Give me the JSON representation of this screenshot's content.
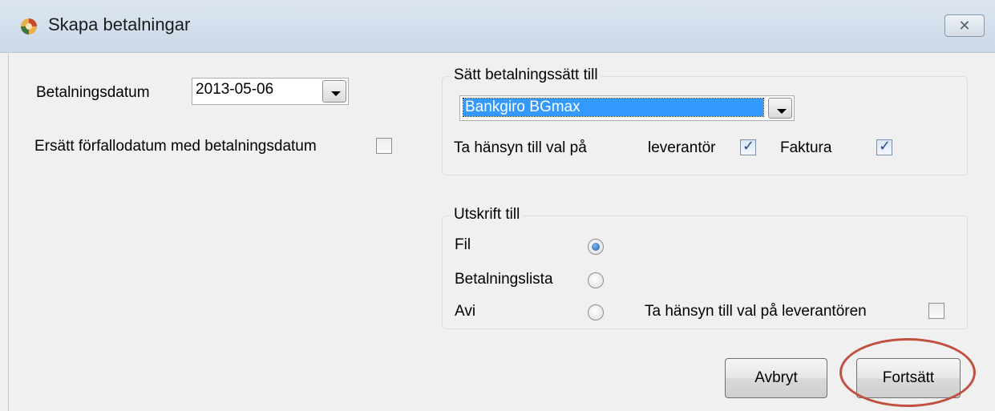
{
  "window": {
    "title": "Skapa betalningar",
    "close_glyph": "✕"
  },
  "form": {
    "payment_date_label": "Betalningsdatum",
    "payment_date_value": "2013-05-06",
    "replace_due_label": "Ersätt förfallodatum med betalningsdatum",
    "replace_due_checked": false
  },
  "payment_method_group": {
    "title": "Sätt betalningssätt till",
    "selected_method": "Bankgiro BGmax",
    "consider_label": "Ta hänsyn till val på",
    "supplier_label": "leverantör",
    "supplier_checked": true,
    "invoice_label": "Faktura",
    "invoice_checked": true
  },
  "print_group": {
    "title": "Utskrift till",
    "options": [
      {
        "label": "Fil",
        "checked": true
      },
      {
        "label": "Betalningslista",
        "checked": false
      },
      {
        "label": "Avi",
        "checked": false
      }
    ],
    "consider_supplier_label": "Ta hänsyn till val på leverantören",
    "consider_supplier_checked": false
  },
  "buttons": {
    "cancel_label": "Avbryt",
    "continue_label": "Fortsätt"
  },
  "colors": {
    "selection": "#3399ff",
    "annotation": "#c0503f"
  }
}
